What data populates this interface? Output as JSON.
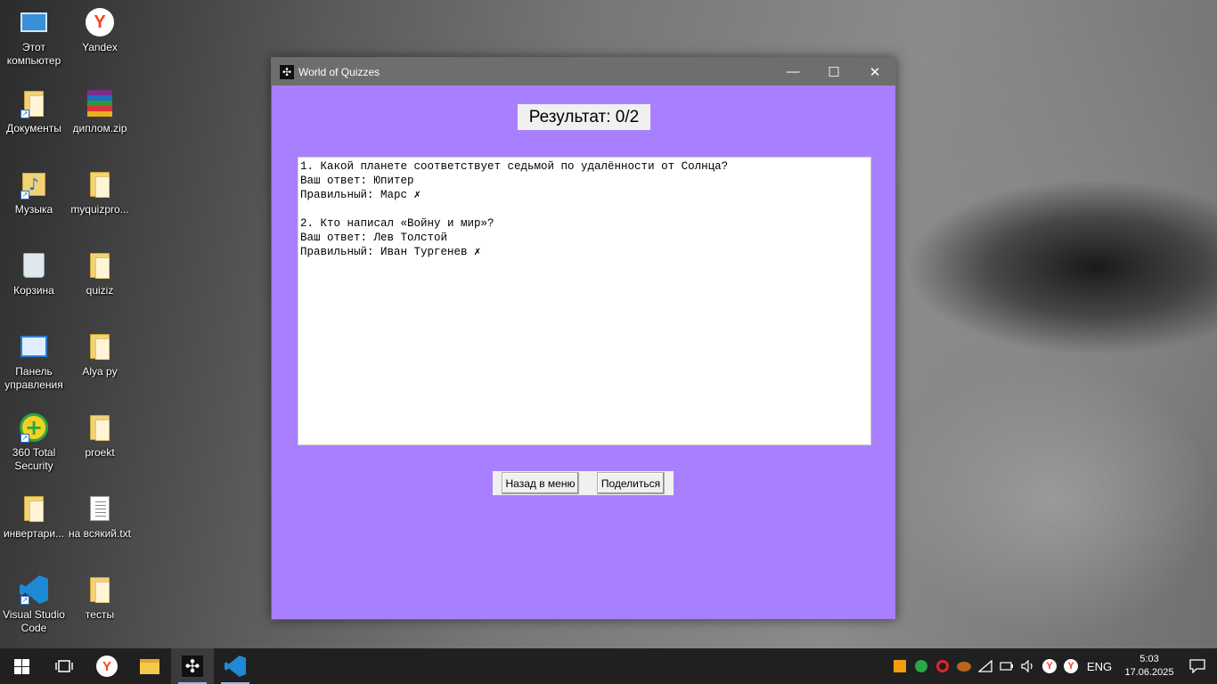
{
  "desktop": {
    "icons": [
      {
        "label": "Этот компьютер"
      },
      {
        "label": "Yandex"
      },
      {
        "label": "Документы"
      },
      {
        "label": "диплом.zip"
      },
      {
        "label": "Музыка"
      },
      {
        "label": "myquizpro..."
      },
      {
        "label": "Корзина"
      },
      {
        "label": "quiziz"
      },
      {
        "label": "Панель управления"
      },
      {
        "label": "Alya py"
      },
      {
        "label": "360 Total Security"
      },
      {
        "label": "proekt"
      },
      {
        "label": "инвертари..."
      },
      {
        "label": "на всякий.txt"
      },
      {
        "label": "Visual Studio Code"
      },
      {
        "label": "тесты"
      }
    ]
  },
  "window": {
    "title": "World of Quizzes",
    "minimize_glyph": "—",
    "maximize_glyph": "☐",
    "close_glyph": "✕",
    "result_label": "Результат: 0/2",
    "results_lines": [
      "1. Какой планете соответствует седьмой по удалённости от Солнца?",
      "Ваш ответ: Юпитер",
      "Правильный: Марс ✗",
      "",
      "2. Кто написал «Войну и мир»?",
      "Ваш ответ: Лев Толстой",
      "Правильный: Иван Тургенев ✗"
    ],
    "buttons": {
      "back": "Назад в меню",
      "share": "Поделиться"
    }
  },
  "taskbar": {
    "language": "ENG",
    "time": "5:03",
    "date": "17.06.2025"
  }
}
